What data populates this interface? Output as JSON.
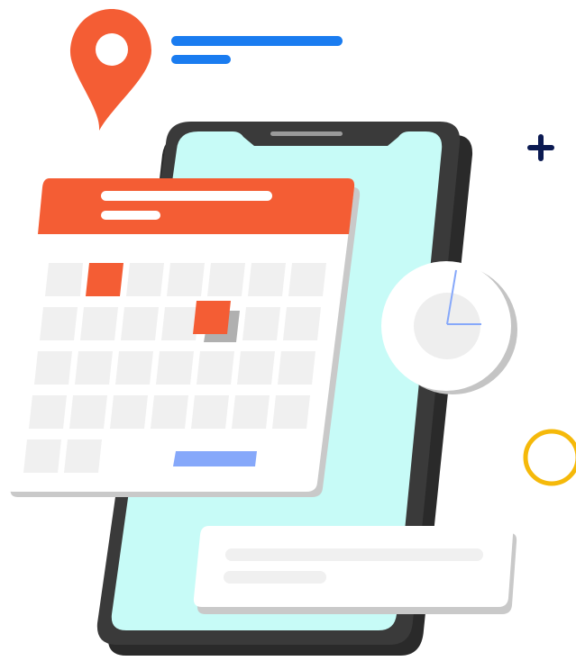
{
  "colors": {
    "accent_orange": "#F45D34",
    "accent_blue": "#1A7CF0",
    "phone_screen": "#C7FBF7",
    "phone_body": "#3A3A3A",
    "phone_shadow": "#2A2A2A",
    "card_white": "#FFFFFF",
    "card_shadow": "#C9C9C9",
    "cell_gray": "#F0F0F0",
    "highlight_blue": "#86A8FA",
    "clock_hand": "#86A8FA",
    "plus_navy": "#0B1A52",
    "ring_yellow": "#F5B90A"
  },
  "icons": {
    "location_pin": "map-pin-icon",
    "calendar": "calendar-icon",
    "clock": "clock-icon",
    "plus": "plus-icon",
    "ring": "circle-icon"
  },
  "calendar": {
    "rows": 5,
    "columns": 7,
    "highlighted_cells": [
      {
        "row": 0,
        "col": 1
      },
      {
        "row": 1,
        "col": 4
      }
    ],
    "visible_cells_last_row": 2
  }
}
